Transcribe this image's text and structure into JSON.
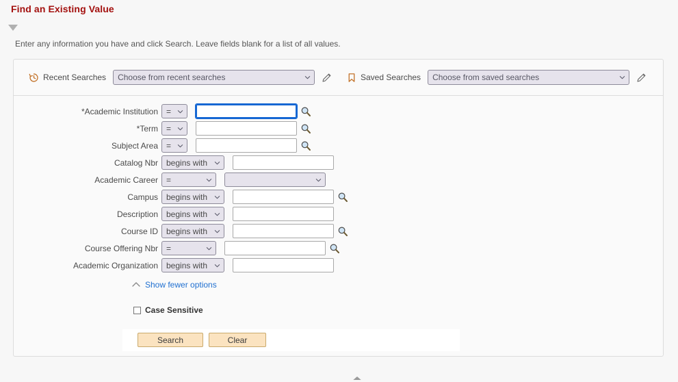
{
  "page": {
    "title": "Find an Existing Value",
    "instructions": "Enter any information you have and click Search. Leave fields blank for a list of all values.",
    "section_toggle_icon": "triangle-down-icon",
    "scroll_top_icon": "chevron-up-icon"
  },
  "searches": {
    "recent": {
      "icon": "history-clock-icon",
      "label": "Recent Searches",
      "placeholder": "Choose from recent searches",
      "value": "",
      "edit_icon": "pencil-icon"
    },
    "saved": {
      "icon": "bookmark-icon",
      "label": "Saved Searches",
      "placeholder": "Choose from saved searches",
      "value": "",
      "edit_icon": "pencil-icon"
    }
  },
  "criteria": {
    "fields": [
      {
        "label": "*Academic Institution",
        "operator": "=",
        "op_width": "narrow",
        "control": "text",
        "value": "",
        "lookup": true,
        "focused": true
      },
      {
        "label": "*Term",
        "operator": "=",
        "op_width": "narrow",
        "control": "text",
        "value": "",
        "lookup": true,
        "focused": false
      },
      {
        "label": "Subject Area",
        "operator": "=",
        "op_width": "narrow",
        "control": "text",
        "value": "",
        "lookup": true,
        "focused": false
      },
      {
        "label": "Catalog Nbr",
        "operator": "begins with",
        "op_width": "wide",
        "control": "text",
        "value": "",
        "lookup": false,
        "focused": false
      },
      {
        "label": "Academic Career",
        "operator": "=",
        "op_width": "med",
        "control": "select",
        "value": "",
        "lookup": false,
        "focused": false
      },
      {
        "label": "Campus",
        "operator": "begins with",
        "op_width": "wide",
        "control": "text",
        "value": "",
        "lookup": true,
        "focused": false
      },
      {
        "label": "Description",
        "operator": "begins with",
        "op_width": "wide",
        "control": "text",
        "value": "",
        "lookup": false,
        "focused": false
      },
      {
        "label": "Course ID",
        "operator": "begins with",
        "op_width": "wide",
        "control": "text",
        "value": "",
        "lookup": true,
        "focused": false
      },
      {
        "label": "Course Offering Nbr",
        "operator": "=",
        "op_width": "med",
        "control": "text",
        "value": "",
        "lookup": true,
        "focused": false
      },
      {
        "label": "Academic Organization",
        "operator": "begins with",
        "op_width": "wide",
        "control": "text",
        "value": "",
        "lookup": false,
        "focused": false
      }
    ],
    "show_fewer": {
      "icon": "chevron-up-icon",
      "label": "Show fewer options"
    },
    "case_sensitive": {
      "label": "Case Sensitive",
      "checked": false
    }
  },
  "actions": {
    "search_label": "Search",
    "clear_label": "Clear"
  },
  "colors": {
    "title_red": "#a3100e",
    "link_blue": "#1f6fd0",
    "focus_blue": "#1567d3",
    "button_peach": "#fbe3c0",
    "button_border": "#c9a96b",
    "select_fill": "#e6e3ec",
    "icon_orange": "#c3732a",
    "page_bg": "#f7f7f7",
    "panel_bg": "#fafafa"
  }
}
